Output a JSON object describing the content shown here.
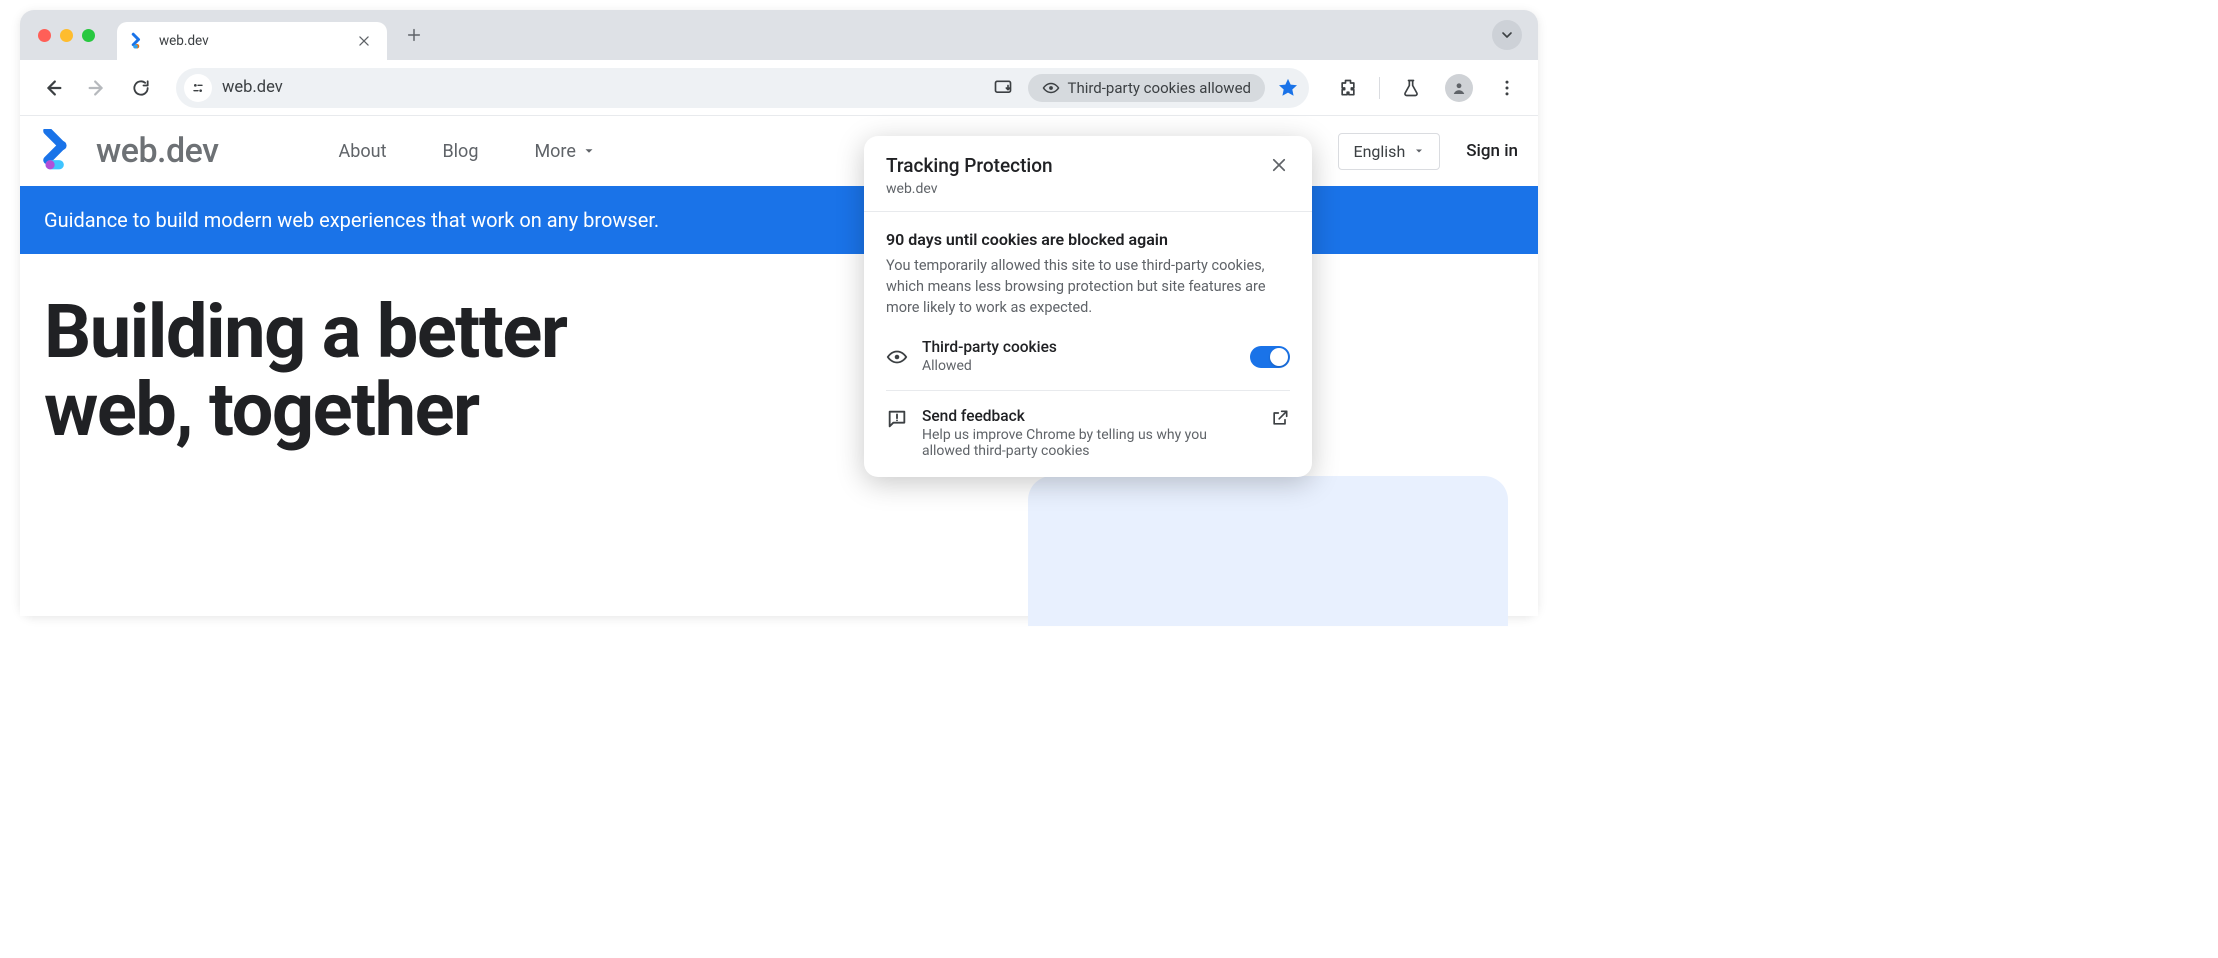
{
  "browser": {
    "tab_title": "web.dev",
    "url": "web.dev",
    "cookie_chip_label": "Third-party cookies allowed"
  },
  "site": {
    "name": "web.dev",
    "nav": {
      "about": "About",
      "blog": "Blog",
      "more": "More"
    },
    "language": "English",
    "signin": "Sign in",
    "banner": "Guidance to build modern web experiences that work on any browser.",
    "hero_line1": "Building a better",
    "hero_line2": "web, together"
  },
  "popup": {
    "title": "Tracking Protection",
    "domain": "web.dev",
    "countdown_title": "90 days until cookies are blocked again",
    "countdown_body": "You temporarily allowed this site to use third-party cookies, which means less browsing protection but site features are more likely to work as expected.",
    "tpc_title": "Third-party cookies",
    "tpc_status": "Allowed",
    "feedback_title": "Send feedback",
    "feedback_body": "Help us improve Chrome by telling us why you allowed third-party cookies"
  }
}
